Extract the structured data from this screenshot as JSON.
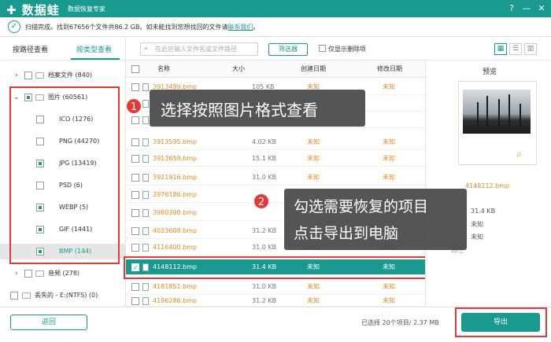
{
  "app": {
    "title": "数据蛙",
    "subtitle": "数据恢复专家"
  },
  "status": {
    "text": "扫描完成。找到67656个文件共86.2 GB。如未能找到您想找回的文件请",
    "link": "联系我们",
    "link_end": "。"
  },
  "tabs": {
    "path": "按路径查看",
    "type": "按类型查看"
  },
  "tree": [
    {
      "label": "档案文件 (840)"
    },
    {
      "label": "图片 (60561)"
    },
    {
      "label": "ICO (1276)"
    },
    {
      "label": "PNG (44270)"
    },
    {
      "label": "JPG (13419)"
    },
    {
      "label": "PSD (6)"
    },
    {
      "label": "WEBP (5)"
    },
    {
      "label": "GIF (1441)"
    },
    {
      "label": "BMP (144)"
    },
    {
      "label": "音频 (278)"
    },
    {
      "label": "丢失的 - E:(NTFS) (0)"
    }
  ],
  "search": {
    "placeholder": "在此处输入文件名或文件路径"
  },
  "toolbar": {
    "filter": "筛选器",
    "only_deleted": "仅显示删除项"
  },
  "columns": {
    "name": "名称",
    "size": "大小",
    "created": "创建日期",
    "modified": "修改日期"
  },
  "files": [
    {
      "name": "3913499.bmp",
      "size": "105 KB",
      "created": "未知",
      "modified": "未知"
    },
    {
      "name": "",
      "size": "",
      "created": "",
      "modified": ""
    },
    {
      "name": "",
      "size": "",
      "created": "",
      "modified": ""
    },
    {
      "name": "3913595.bmp",
      "size": "4.02 KB",
      "created": "未知",
      "modified": "未知"
    },
    {
      "name": "3913659.bmp",
      "size": "15.1 KB",
      "created": "未知",
      "modified": "未知"
    },
    {
      "name": "3921916.bmp",
      "size": "31.0 KB",
      "created": "未知",
      "modified": "未知"
    },
    {
      "name": "3976186.bmp",
      "size": "",
      "created": "",
      "modified": ""
    },
    {
      "name": "3980398.bmp",
      "size": "",
      "created": "",
      "modified": ""
    },
    {
      "name": "4023608.bmp",
      "size": "31.2 KB",
      "created": "",
      "modified": ""
    },
    {
      "name": "4116400.bmp",
      "size": "31.0 KB",
      "created": "未知",
      "modified": "未知"
    },
    {
      "name": "4148112.bmp",
      "size": "31.4 KB",
      "created": "未知",
      "modified": "未知"
    },
    {
      "name": "4181851.bmp",
      "size": "31.0 KB",
      "created": "未知",
      "modified": "未知"
    },
    {
      "name": "4196286.bmp",
      "size": "31.2 KB",
      "created": "未知",
      "modified": "未知"
    }
  ],
  "preview": {
    "title": "预览",
    "filename": "4148112.bmp",
    "size": "31.4 KB",
    "created": "未知",
    "modified": "未知",
    "path_label": "路径"
  },
  "callouts": [
    {
      "num": "1",
      "text": "选择按照图片格式查看"
    },
    {
      "num": "2",
      "line1": "勾选需要恢复的项目",
      "line2": "点击导出到电脑"
    }
  ],
  "bottom": {
    "back": "返回",
    "selected": "已选择 20个项目/ 2.37 MB",
    "export": "导出"
  },
  "colors": {
    "accent": "#1a9a8e",
    "highlight": "#e53935",
    "filename": "#e08a1e"
  }
}
